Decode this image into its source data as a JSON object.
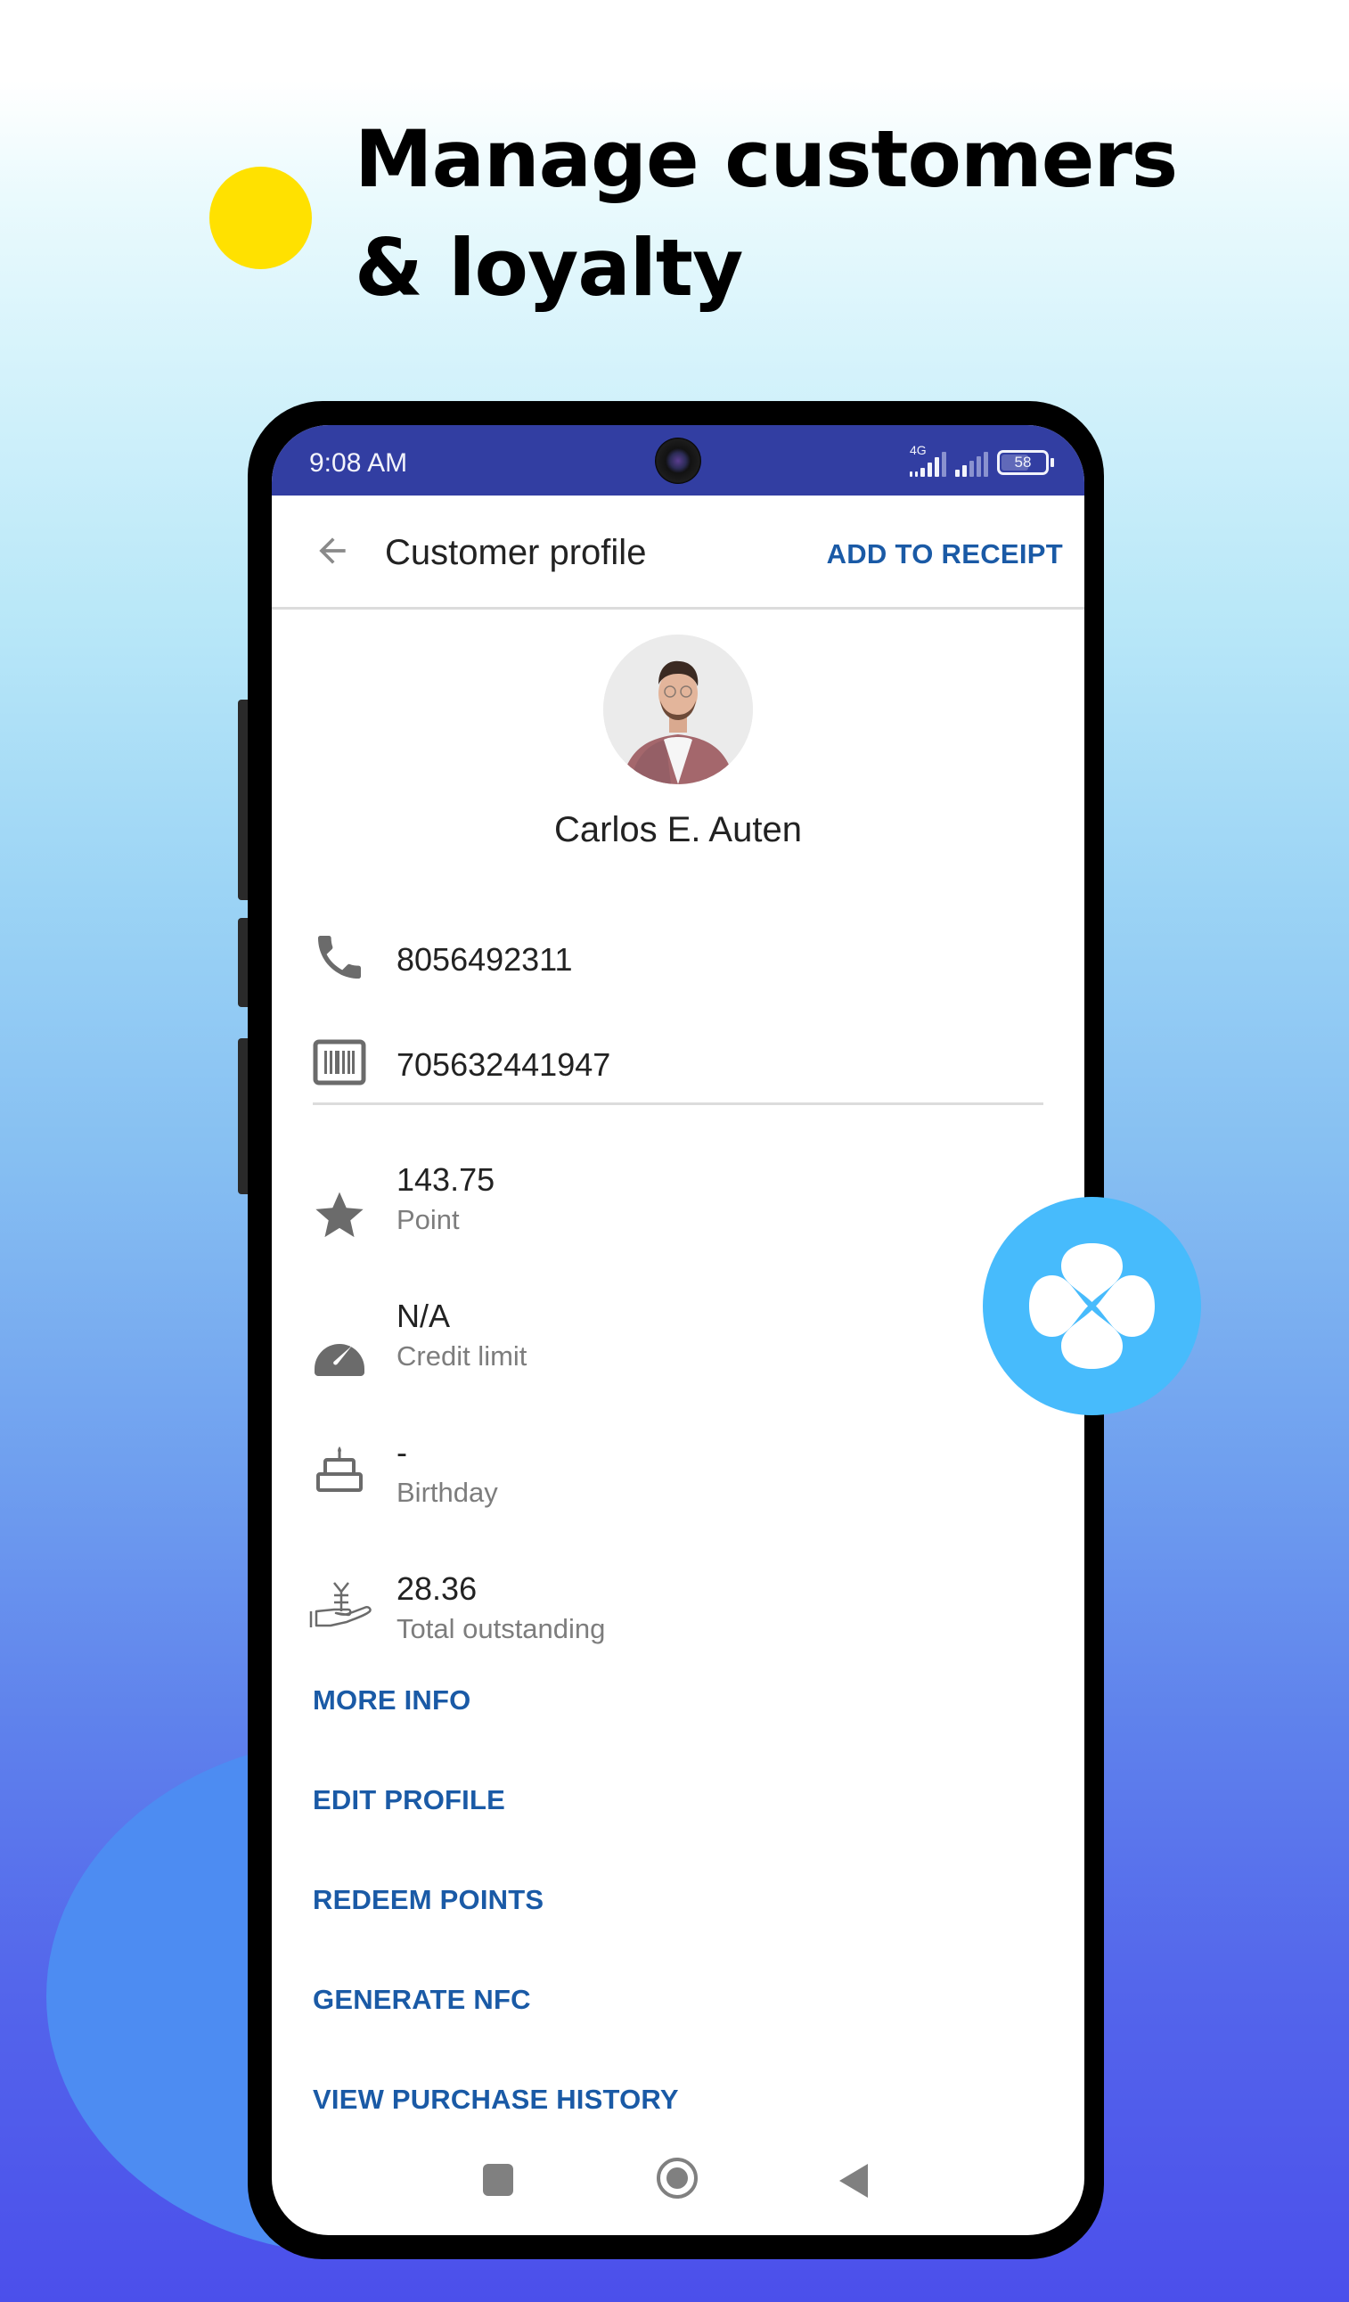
{
  "headline": {
    "line1": "Manage customers",
    "line2": "& loyalty"
  },
  "colors": {
    "accent_dot": "#ffe100",
    "status_bar": "#323ea2",
    "link_blue": "#1a5aa6",
    "fab_blue": "#47bbfc"
  },
  "status_bar": {
    "time": "9:08 AM",
    "network": "4G",
    "battery": "58",
    "battery_level_percent": 58
  },
  "app_bar": {
    "back_icon": "arrow-left-icon",
    "title": "Customer profile",
    "action_label": "ADD TO RECEIPT"
  },
  "customer": {
    "name": "Carlos  E. Auten",
    "avatar": "customer-photo",
    "phone": {
      "icon": "phone-icon",
      "value": "8056492311"
    },
    "barcode": {
      "icon": "barcode-icon",
      "value": "705632441947"
    },
    "details": [
      {
        "icon": "star-icon",
        "value": "143.75",
        "label": "Point"
      },
      {
        "icon": "speedometer-icon",
        "value": "N/A",
        "label": "Credit limit"
      },
      {
        "icon": "cake-icon",
        "value": "-",
        "label": "Birthday"
      },
      {
        "icon": "hand-money-icon",
        "value": "28.36",
        "label": "Total outstanding"
      }
    ]
  },
  "actions": [
    "MORE INFO",
    "EDIT PROFILE",
    "REDEEM POINTS",
    "GENERATE NFC",
    "VIEW PURCHASE HISTORY"
  ],
  "nav_bar": {
    "recent_icon": "square-icon",
    "home_icon": "circle-home-icon",
    "back_icon": "triangle-back-icon"
  },
  "fab": {
    "icon": "clover-logo-icon"
  }
}
